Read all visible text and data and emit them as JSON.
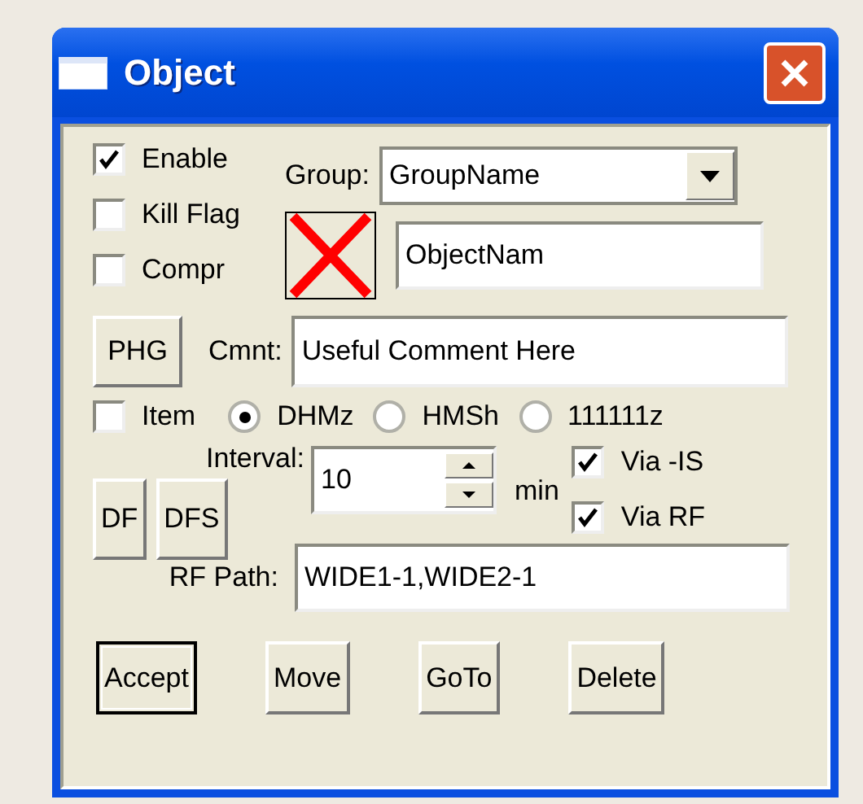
{
  "window": {
    "title": "Object"
  },
  "flags": [
    {
      "label": "Enable",
      "checked": true
    },
    {
      "label": "Kill Flag",
      "checked": false
    },
    {
      "label": "Compr",
      "checked": false
    }
  ],
  "group": {
    "label": "Group:",
    "value": "GroupName"
  },
  "name": {
    "value": "ObjectNam"
  },
  "phg_button": "PHG",
  "comment": {
    "label": "Cmnt:",
    "value": "Useful Comment Here"
  },
  "item": {
    "label": "Item",
    "checked": false
  },
  "time_formats": [
    {
      "label": "DHMz",
      "selected": true
    },
    {
      "label": "HMSh",
      "selected": false
    },
    {
      "label": "111111z",
      "selected": false
    }
  ],
  "interval": {
    "label": "Interval:",
    "value": "10",
    "unit": "min"
  },
  "df_buttons": [
    "DF",
    "DFS"
  ],
  "via": [
    {
      "label": "Via -IS",
      "checked": true
    },
    {
      "label": "Via RF",
      "checked": true
    }
  ],
  "rf_path": {
    "label": "RF Path:",
    "value": "WIDE1-1,WIDE2-1"
  },
  "buttons": [
    {
      "label": "Accept",
      "default": true
    },
    {
      "label": "Move",
      "default": false
    },
    {
      "label": "GoTo",
      "default": false
    },
    {
      "label": "Delete",
      "default": false
    }
  ]
}
